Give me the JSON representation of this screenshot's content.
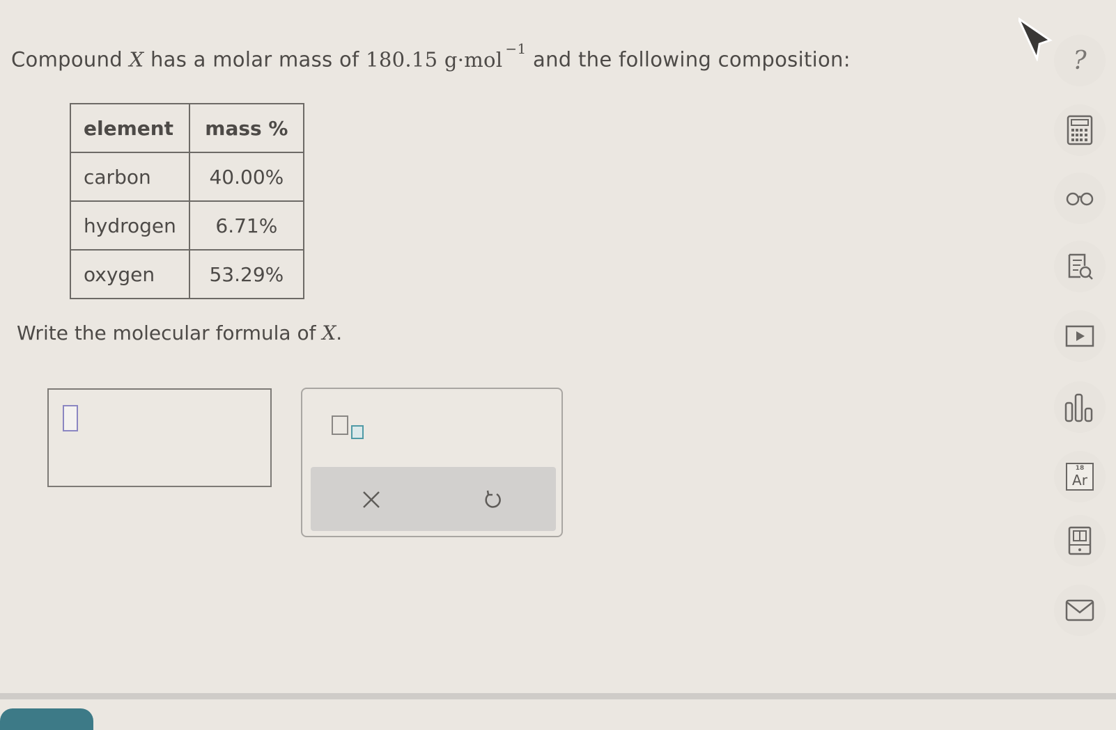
{
  "question": {
    "before_x": "Compound",
    "x_symbol": "X",
    "after_x": "has a molar mass of",
    "mass_value": "180.15",
    "unit": "g·mol",
    "exponent": "−1",
    "tail": "and the following composition:"
  },
  "table": {
    "headers": [
      "element",
      "mass %"
    ],
    "rows": [
      {
        "element": "carbon",
        "mass": "40.00%"
      },
      {
        "element": "hydrogen",
        "mass": "6.71%"
      },
      {
        "element": "oxygen",
        "mass": "53.29%"
      }
    ]
  },
  "prompt": {
    "text": "Write the molecular formula of",
    "symbol": "X",
    "end": "."
  },
  "answer": {
    "value": ""
  },
  "keypad": {
    "subscript_icon": "subscript-template-icon",
    "clear_icon": "close-icon",
    "undo_icon": "undo-icon"
  },
  "sidebar": {
    "help_label": "?",
    "periodic_number": "18",
    "periodic_symbol": "Ar",
    "icons": [
      "help-icon",
      "calculator-icon",
      "reference-glasses-icon",
      "notes-icon",
      "video-icon",
      "data-chart-icon",
      "periodic-table-icon",
      "textbook-icon",
      "message-icon"
    ]
  },
  "colors": {
    "background": "#ebe7e1",
    "text": "#4d4a47",
    "accent_teal": "#4f9aa6",
    "cursor_purple": "#8b86c2"
  }
}
